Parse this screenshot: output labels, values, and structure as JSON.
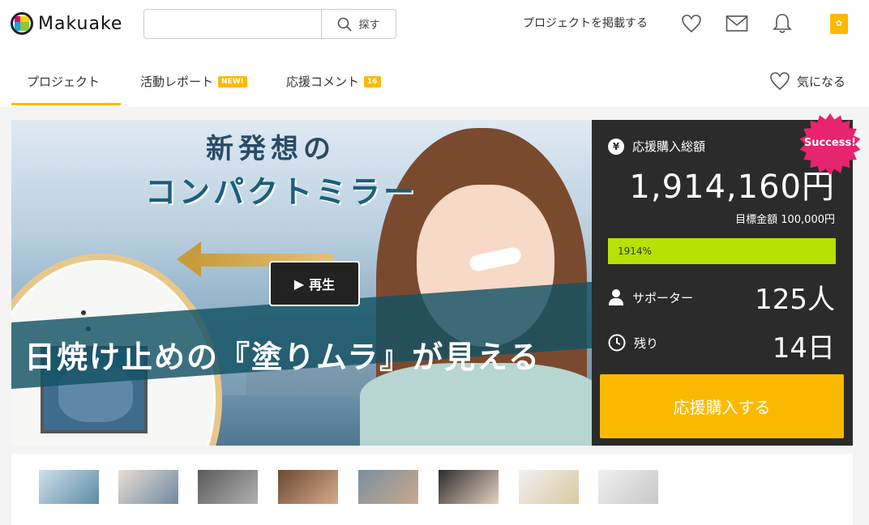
{
  "header": {
    "logo_text": "Makuake",
    "search": {
      "placeholder": "",
      "button_label": "探す"
    },
    "post_project_label": "プロジェクトを掲載する",
    "icons": [
      "heart-icon",
      "mail-icon",
      "bell-icon"
    ],
    "user_badge_text": "✿"
  },
  "tabs": {
    "items": [
      {
        "label": "プロジェクト",
        "active": true
      },
      {
        "label": "活動レポート",
        "tag": "NEW!"
      },
      {
        "label": "応援コメント",
        "tag": "16"
      }
    ],
    "favorite_label": "気になる"
  },
  "hero": {
    "title_line1": "新発想の",
    "title_line2": "コンパクトミラー",
    "banner_text": "日焼け止めの『塗りムラ』が見える",
    "play_label": "再生"
  },
  "panel": {
    "success_label": "Success!",
    "raised_label": "応援購入総額",
    "raised_amount": "1,914,160円",
    "goal_text": "目標金額 100,000円",
    "progress_text": "1914%",
    "progress_fraction": 1.0,
    "supporters_label": "サポーター",
    "supporters_value": "125人",
    "remaining_label": "残り",
    "remaining_value": "14日",
    "cta_label": "応援購入する"
  },
  "thumbnails": [
    {
      "colors": [
        "#cfe0ea",
        "#5d8ba6"
      ]
    },
    {
      "colors": [
        "#e9ddd3",
        "#6f8aa0"
      ]
    },
    {
      "colors": [
        "#5a5a5a",
        "#b0b0b0"
      ]
    },
    {
      "colors": [
        "#6b4a34",
        "#d8a98a"
      ]
    },
    {
      "colors": [
        "#7a8fa0",
        "#c9a98e"
      ]
    },
    {
      "colors": [
        "#2d2d2d",
        "#e6d0c0"
      ]
    },
    {
      "colors": [
        "#f2f2f2",
        "#d9c7a0"
      ]
    },
    {
      "colors": [
        "#f0f0f0",
        "#c8c8c8"
      ]
    }
  ],
  "colors": {
    "accent": "#fbb900",
    "panel_bg": "#2b2b2b",
    "progress": "#b7e100",
    "success": "#e6246f"
  }
}
